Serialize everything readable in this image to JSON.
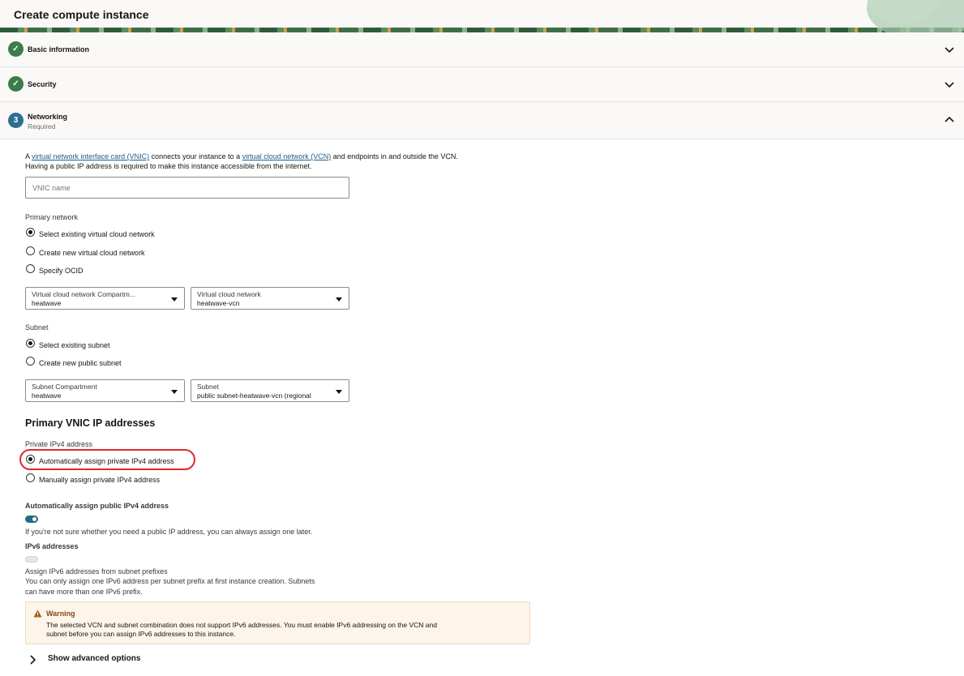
{
  "header": {
    "title": "Create compute instance"
  },
  "sections": [
    {
      "title": "Basic information",
      "status": "complete"
    },
    {
      "title": "Security",
      "status": "complete"
    },
    {
      "title": "Networking",
      "step": "3",
      "subtitle": "Required",
      "status": "expanded"
    }
  ],
  "intro": {
    "prefix": "A",
    "link1": "virtual network interface card (VNIC)",
    "mid": "connects your instance to a",
    "link2": "virtual cloud network (VCN)",
    "suffix": "and endpoints in and outside the VCN.",
    "line2": "Having a public IP address is required to make this instance accessible from the internet."
  },
  "vnic_name": {
    "placeholder": "VNIC name",
    "value": ""
  },
  "primary_network": {
    "label": "Primary network",
    "options": [
      "Select existing virtual cloud network",
      "Create new virtual cloud network",
      "Specify OCID"
    ],
    "selected": 0
  },
  "vcn_compartment": {
    "label": "Virtual cloud network Compartm...",
    "value": "heatwave"
  },
  "vcn": {
    "label": "Virtual cloud network",
    "value": "heatwave-vcn"
  },
  "subnet": {
    "label": "Subnet",
    "options": [
      "Select existing subnet",
      "Create new public subnet"
    ],
    "selected": 0
  },
  "subnet_compartment": {
    "label": "Subnet Compartment",
    "value": "heatwave"
  },
  "subnet_select": {
    "label": "Subnet",
    "value": "public subnet-heatwave-vcn (regional"
  },
  "ip_section": {
    "heading": "Primary VNIC IP addresses",
    "private_label": "Private IPv4 address",
    "options": [
      "Automatically assign private IPv4 address",
      "Manually assign private IPv4 address"
    ],
    "selected": 0
  },
  "public_ip": {
    "label": "Automatically assign public IPv4 address",
    "enabled": true,
    "help": "If you're not sure whether you need a public IP address, you can always assign one later."
  },
  "ipv6": {
    "label": "IPv6 addresses",
    "enabled": false,
    "toggle_label": "Assign IPv6 addresses from subnet prefixes",
    "help1": "You can only assign one IPv6 address per subnet prefix at first instance creation. Subnets",
    "help2": "can have more than one IPv6 prefix."
  },
  "warning": {
    "title": "Warning",
    "line1": "The selected VCN and subnet combination does not support IPv6 addresses. You must enable IPv6 addressing on the VCN and",
    "line2": "subnet before you can assign IPv6 addresses to this instance."
  },
  "advanced": {
    "label": "Show advanced options"
  }
}
